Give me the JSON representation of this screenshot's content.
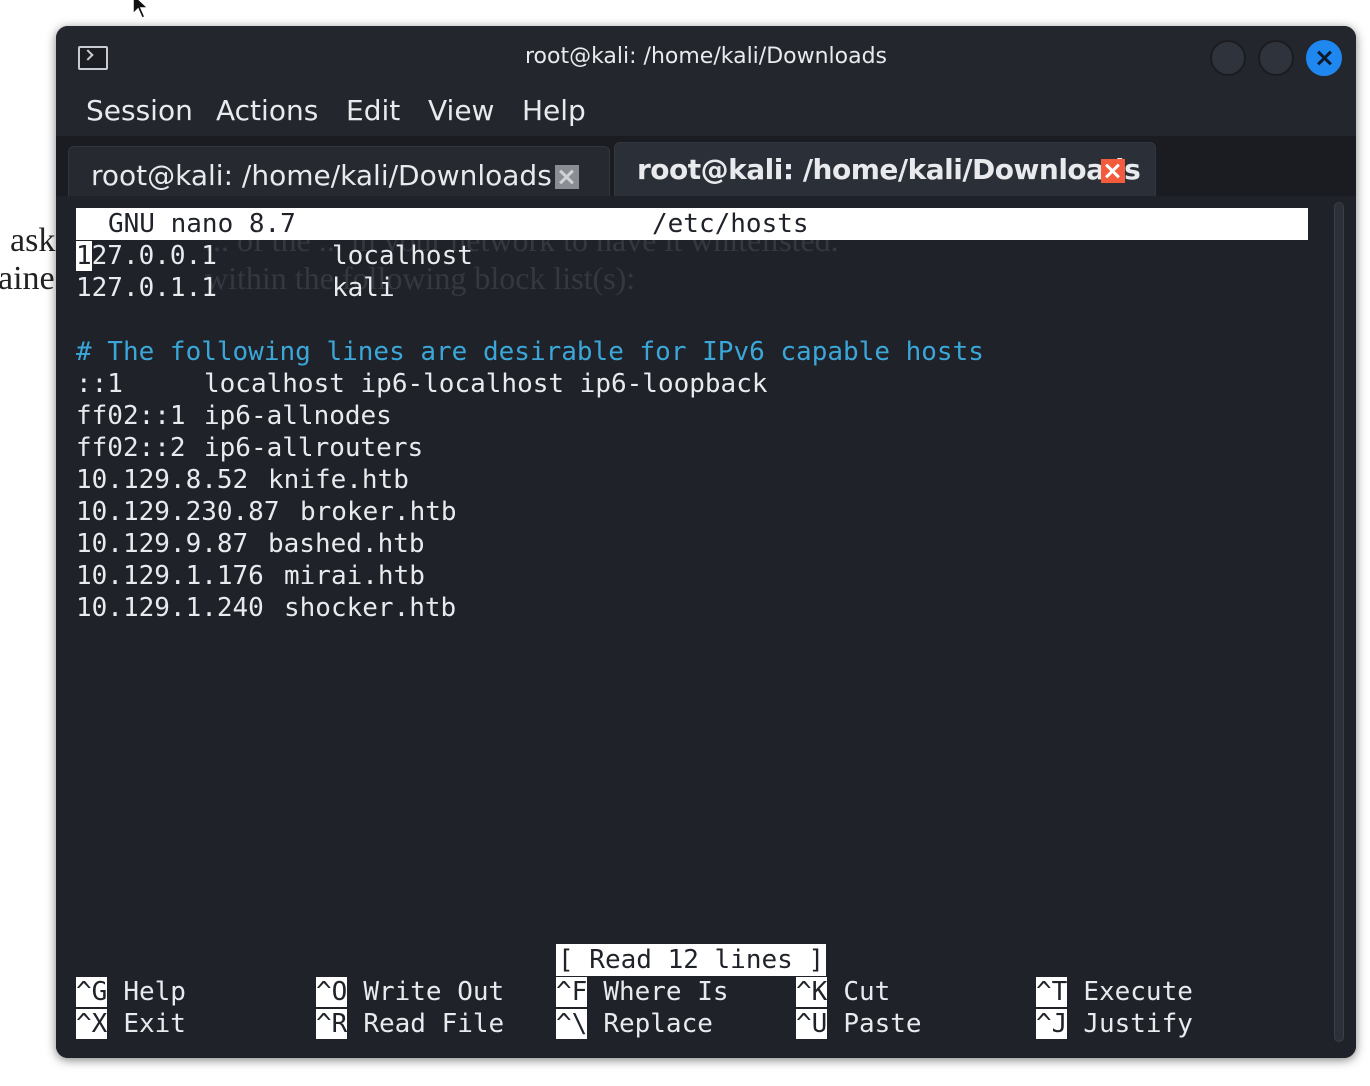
{
  "background_page": {
    "line1": "ask",
    "line2": "aine",
    "ghost1": "... of the ... in your network to have it whitelisted.",
    "ghost2": "within the following block list(s):"
  },
  "window": {
    "title": "root@kali: /home/kali/Downloads",
    "close_color": "#1e88f0"
  },
  "menu": [
    "Session",
    "Actions",
    "Edit",
    "View",
    "Help"
  ],
  "tabs": [
    {
      "label": "root@kali: /home/kali/Downloads",
      "active": false
    },
    {
      "label": "root@kali: /home/kali/Downloads",
      "active": true
    }
  ],
  "nano": {
    "version": "GNU nano 8.7",
    "filename": "/etc/hosts",
    "caret_char": "1",
    "first_line_rest": "27.0.0.1",
    "lines": [
      {
        "ip": "127.0.0.1",
        "host": "localhost"
      },
      {
        "ip": "127.0.1.1",
        "host": "kali"
      },
      {
        "ip": "",
        "host": ""
      },
      {
        "comment": "# The following lines are desirable for IPv6 capable hosts"
      },
      {
        "ip": "::1",
        "host": "localhost ip6-localhost ip6-loopback"
      },
      {
        "ip": "ff02::1",
        "host": "ip6-allnodes"
      },
      {
        "ip": "ff02::2",
        "host": "ip6-allrouters"
      },
      {
        "ip": "10.129.8.52",
        "host": "knife.htb"
      },
      {
        "ip": "10.129.230.87",
        "host": "broker.htb"
      },
      {
        "ip": "10.129.9.87",
        "host": "bashed.htb"
      },
      {
        "ip": "10.129.1.176",
        "host": "mirai.htb"
      },
      {
        "ip": "10.129.1.240",
        "host": "shocker.htb"
      }
    ],
    "status": "[ Read 12 lines ]",
    "shortcuts": [
      {
        "key": "^G",
        "label": "Help"
      },
      {
        "key": "^X",
        "label": "Exit"
      },
      {
        "key": "^O",
        "label": "Write Out"
      },
      {
        "key": "^R",
        "label": "Read File"
      },
      {
        "key": "^F",
        "label": "Where Is"
      },
      {
        "key": "^\\",
        "label": "Replace"
      },
      {
        "key": "^K",
        "label": "Cut"
      },
      {
        "key": "^U",
        "label": "Paste"
      },
      {
        "key": "^T",
        "label": "Execute"
      },
      {
        "key": "^J",
        "label": "Justify"
      }
    ],
    "comment_color": "#3ba7d9"
  }
}
